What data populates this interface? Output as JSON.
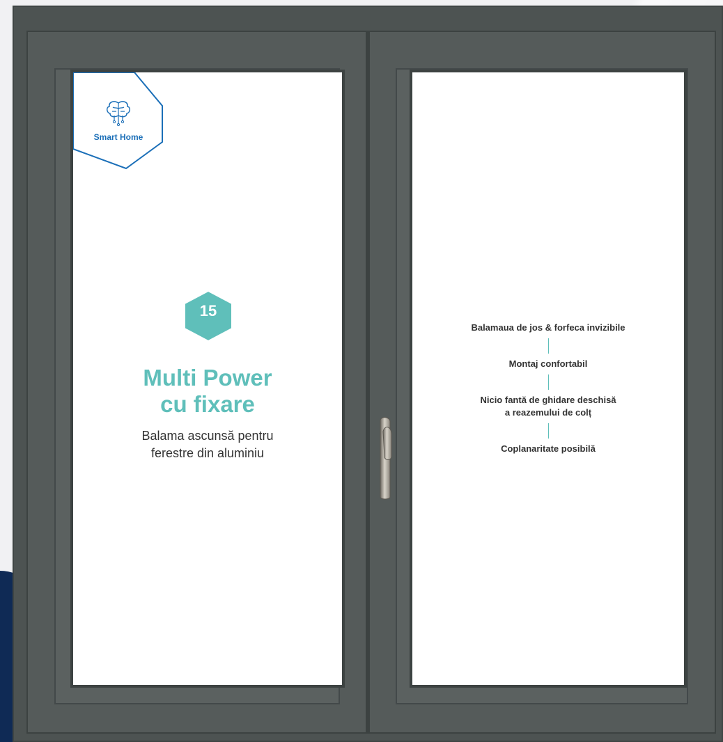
{
  "badge": {
    "label": "Smart Home",
    "icon": "brain-circuit-icon",
    "color": "#1b6fb8"
  },
  "product": {
    "number": "15",
    "title_line1": "Multi Power",
    "title_line2": "cu fixare",
    "subtitle_line1": "Balama ascunsă pentru",
    "subtitle_line2": "ferestre din aluminiu",
    "accent_color": "#5fbfba"
  },
  "features": [
    {
      "line1": "Balamaua de jos & forfeca invizibile"
    },
    {
      "line1": "Montaj confortabil"
    },
    {
      "line1": "Nicio fantă de ghidare deschisă",
      "line2": "a reazemului de colț"
    },
    {
      "line1": "Coplanaritate posibilă"
    }
  ],
  "frame_color": "#4d5352"
}
